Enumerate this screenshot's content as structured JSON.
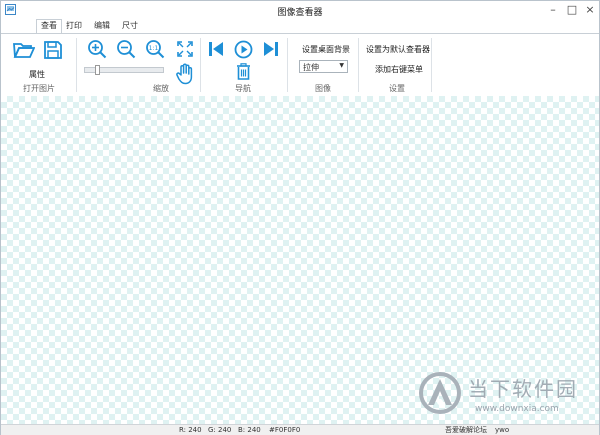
{
  "window": {
    "title": "图像查看器"
  },
  "tabs": [
    {
      "label": "查看",
      "active": true
    },
    {
      "label": "打印"
    },
    {
      "label": "编辑"
    },
    {
      "label": "尺寸"
    }
  ],
  "ribbon": {
    "open_group": {
      "label": "打开图片",
      "properties_label": "属性",
      "icons": [
        "folder-open-icon",
        "save-icon"
      ]
    },
    "zoom_group": {
      "label": "缩放",
      "icons": [
        "zoom-in-icon",
        "zoom-out-icon",
        "actual-size-icon",
        "fit-screen-icon",
        "pan-hand-icon"
      ],
      "slider_value": 0.15
    },
    "nav_group": {
      "label": "导航",
      "icons": [
        "previous-icon",
        "play-icon",
        "next-icon",
        "delete-icon"
      ]
    },
    "image_group": {
      "label": "图像",
      "wallpaper_label": "设置桌面背景",
      "stretch_value": "拉伸"
    },
    "settings_group": {
      "label": "设置",
      "default_viewer_label": "设置为默认查看器",
      "context_menu_label": "添加右键菜单"
    }
  },
  "watermark": {
    "text": "当下软件园",
    "url": "www.downxia.com"
  },
  "status": {
    "r": "R: 240",
    "g": "G: 240",
    "b": "B: 240",
    "hex": "#F0F0F0",
    "forum": "吾爱破解论坛",
    "user": "ywo"
  },
  "colors": {
    "accent": "#1e8fd6",
    "canvas_check": "#dff2f2"
  }
}
